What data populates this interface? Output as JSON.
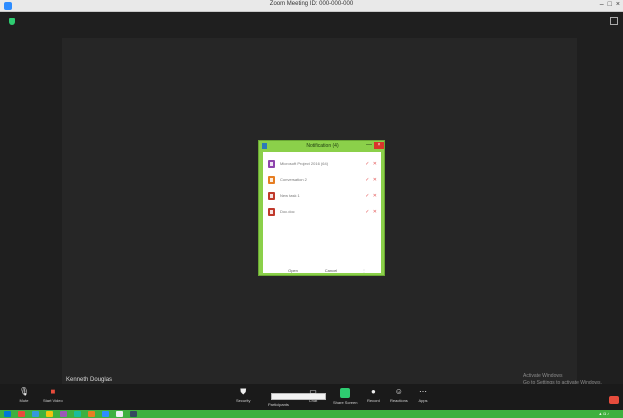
{
  "window": {
    "title": "Zoom Meeting ID: 000-000-000",
    "controls": [
      "–",
      "□",
      "×"
    ]
  },
  "meeting": {
    "participant_name": "Kenneth Douglas",
    "activate_line1": "Activate Windows",
    "activate_line2": "Go to Settings to activate Windows."
  },
  "dialog": {
    "title": "Notification (4)",
    "min_glyph": "—",
    "close_glyph": "×",
    "items": [
      {
        "label": "Microsoft Project 2016 (64)",
        "icon_color": "#8e44ad",
        "actions": "✓ ✕"
      },
      {
        "label": "Conversation 2",
        "icon_color": "#e67e22",
        "actions": "✓ ✕"
      },
      {
        "label": "New task 1",
        "icon_color": "#c0392b",
        "actions": "✓ ✕"
      },
      {
        "label": "Doc.doc",
        "icon_color": "#c0392b",
        "actions": "✓ ✕"
      }
    ],
    "buttons": {
      "ok": "Open",
      "cancel": "Cancel"
    }
  },
  "toolbar": {
    "mute": "Mute",
    "stop_video": "Start Video",
    "security": "Security",
    "participants": "Participants",
    "chat": "Chat",
    "share": "Share Screen",
    "record": "Record",
    "reactions": "Reactions",
    "apps": "Apps"
  },
  "colors": {
    "accent": "#2d8cff",
    "dialog_green": "#8bd04a",
    "end_red": "#e74c3c",
    "taskbar": "#3fb03f"
  }
}
